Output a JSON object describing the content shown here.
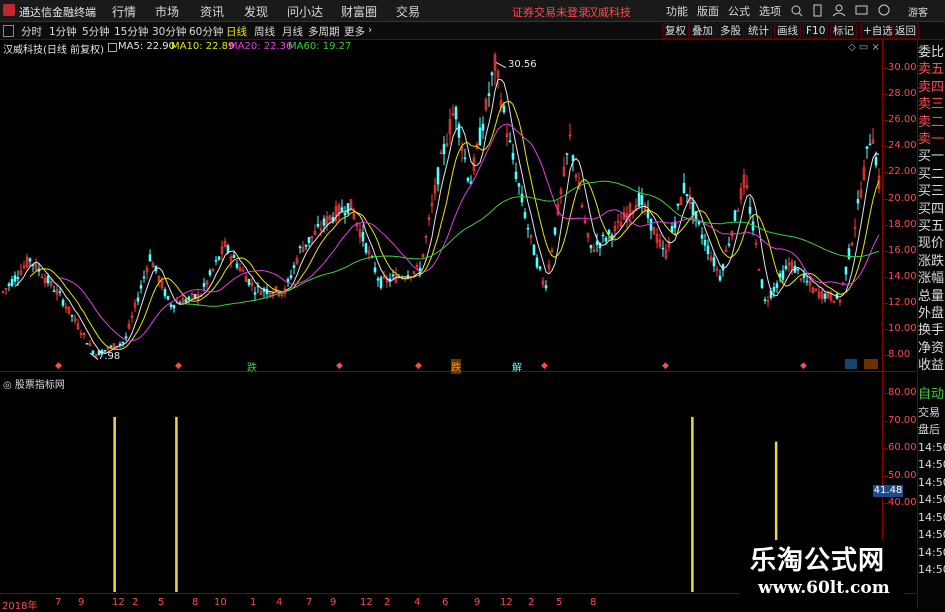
{
  "titlebar": {
    "app_title": "通达信金融终端",
    "menus": [
      "行情",
      "市场",
      "资讯",
      "发现",
      "问小达",
      "财富圈",
      "交易"
    ],
    "warning": "证券交易未登录",
    "stock_name": "汉威科技",
    "right_menus": [
      "功能",
      "版面",
      "公式",
      "选项"
    ],
    "guest": "游客"
  },
  "periods": {
    "tabs": [
      "分时",
      "1分钟",
      "5分钟",
      "15分钟",
      "30分钟",
      "60分钟",
      "日线",
      "周线",
      "月线",
      "多周期",
      "更多"
    ],
    "active": "日线",
    "right_buttons": [
      "复权",
      "叠加",
      "多股",
      "统计",
      "画线",
      "F10",
      "标记",
      "+自选",
      "返回"
    ]
  },
  "info": {
    "title": "汉威科技(日线 前复权)",
    "ma5": "MA5: 22.90",
    "ma10": "MA10: 22.89",
    "ma20": "MA20: 22.36",
    "ma60": "MA60: 19.27"
  },
  "colors": {
    "ma5": "#e6e6e6",
    "ma10": "#e7e700",
    "ma20": "#e040e0",
    "ma60": "#3ccf3c",
    "up": "#ff3c3c",
    "down": "#54ffff",
    "grid": "#8a0000",
    "signal": "#e6d84a"
  },
  "main_axis": {
    "labels": [
      "30.00",
      "28.00",
      "26.00",
      "24.00",
      "22.00",
      "20.00",
      "18.00",
      "16.00",
      "14.00",
      "12.00",
      "10.00",
      "8.00"
    ]
  },
  "annotations": {
    "high": "30.56",
    "low": "7.98"
  },
  "markers": [
    "跌",
    "跌",
    "解"
  ],
  "indicator": {
    "title": "股票指标网",
    "labels": [
      "80.00",
      "70.00",
      "60.00",
      "50.00",
      "40.00"
    ],
    "current": "41.48",
    "signals": [
      {
        "position": 0.13,
        "level": 0.85
      },
      {
        "position": 0.2,
        "level": 0.85
      },
      {
        "position": 0.785,
        "level": 0.85
      },
      {
        "position": 0.88,
        "level": 0.73
      }
    ]
  },
  "xaxis": {
    "labels": [
      "2018年",
      "7",
      "9",
      "12",
      "2",
      "5",
      "8",
      "10",
      "1",
      "4",
      "7",
      "9",
      "12",
      "2",
      "4",
      "6",
      "9",
      "12",
      "2",
      "5",
      "8"
    ]
  },
  "sidebar": {
    "items": [
      "委比",
      "卖五",
      "卖四",
      "卖三",
      "卖二",
      "卖一",
      "买一",
      "买二",
      "买三",
      "买四",
      "买五",
      "现价",
      "涨跌",
      "涨幅",
      "总量",
      "外盘",
      "换手",
      "净资",
      "收益"
    ],
    "bottom": [
      "自动",
      "交易",
      "盘后",
      "14:50",
      "14:50",
      "14:50",
      "14:50",
      "14:50",
      "14:50",
      "14:50",
      "14:50"
    ]
  },
  "watermark": {
    "line1": "乐淘公式网",
    "line2": "www.60lt.com"
  }
}
